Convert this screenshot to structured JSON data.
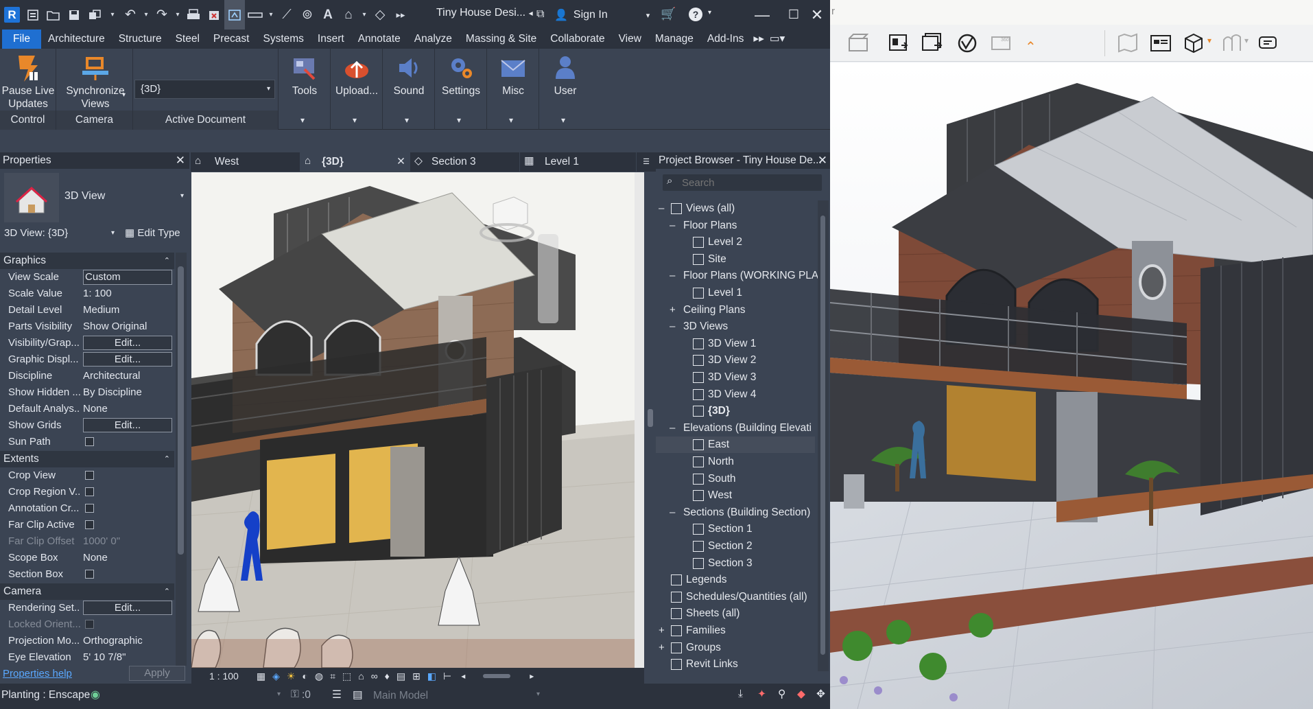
{
  "app": {
    "title": "Tiny House Desi...",
    "sign_in": "Sign In"
  },
  "menu": [
    "File",
    "Architecture",
    "Structure",
    "Steel",
    "Precast",
    "Systems",
    "Insert",
    "Annotate",
    "Analyze",
    "Massing & Site",
    "Collaborate",
    "View",
    "Manage",
    "Add-Ins"
  ],
  "ribbon": {
    "pause": "Pause Live Updates",
    "sync": "Synchronize Views",
    "active_doc_value": "{3D}",
    "tools": "Tools",
    "upload": "Upload...",
    "sound": "Sound",
    "settings": "Settings",
    "misc": "Misc",
    "user": "User",
    "groups": {
      "control": "Control",
      "camera": "Camera",
      "active_document": "Active Document"
    }
  },
  "properties": {
    "title": "Properties",
    "type_name": "3D View",
    "selector": "3D View: {3D}",
    "edit_type": "Edit Type",
    "sections": {
      "graphics": "Graphics",
      "extents": "Extents",
      "camera": "Camera"
    },
    "rows": [
      {
        "k": "View Scale",
        "v": "Custom"
      },
      {
        "k": "Scale Value",
        "pre": "1:",
        "v": "100"
      },
      {
        "k": "Detail Level",
        "v": "Medium"
      },
      {
        "k": "Parts Visibility",
        "v": "Show Original"
      },
      {
        "k": "Visibility/Grap...",
        "v": "Edit..."
      },
      {
        "k": "Graphic Displ...",
        "v": "Edit..."
      },
      {
        "k": "Discipline",
        "v": "Architectural"
      },
      {
        "k": "Show Hidden ...",
        "v": "By Discipline"
      },
      {
        "k": "Default Analys...",
        "v": "None"
      },
      {
        "k": "Show Grids",
        "v": "Edit..."
      },
      {
        "k": "Sun Path",
        "v": ""
      },
      {
        "k": "Crop View",
        "v": ""
      },
      {
        "k": "Crop Region V...",
        "v": ""
      },
      {
        "k": "Annotation Cr...",
        "v": ""
      },
      {
        "k": "Far Clip Active",
        "v": ""
      },
      {
        "k": "Far Clip Offset",
        "v": "1000'  0\""
      },
      {
        "k": "Scope Box",
        "v": "None"
      },
      {
        "k": "Section Box",
        "v": ""
      },
      {
        "k": "Rendering Set...",
        "v": "Edit..."
      },
      {
        "k": "Locked Orient...",
        "v": ""
      },
      {
        "k": "Projection Mo...",
        "v": "Orthographic"
      },
      {
        "k": "Eye Elevation",
        "v": "5'  10 7/8\""
      }
    ],
    "help": "Properties help",
    "apply": "Apply"
  },
  "tabs": [
    "West",
    "{3D}",
    "Section 3",
    "Level 1"
  ],
  "view_bar": {
    "scale": "1 : 100"
  },
  "browser": {
    "title": "Project Browser - Tiny House De...",
    "search_placeholder": "Search",
    "nodes": [
      "Views (all)",
      "Floor Plans",
      "Level 2",
      "Site",
      "Floor Plans (WORKING PLA",
      "Level 1",
      "Ceiling Plans",
      "3D Views",
      "3D View 1",
      "3D View 2",
      "3D View 3",
      "3D View 4",
      "{3D}",
      "Elevations (Building Elevati",
      "East",
      "North",
      "South",
      "West",
      "Sections (Building Section)",
      "Section 1",
      "Section 2",
      "Section 3",
      "Legends",
      "Schedules/Quantities (all)",
      "Sheets (all)",
      "Families",
      "Groups",
      "Revit Links"
    ]
  },
  "status": {
    "text": "Planting : Enscape",
    "count": ":0",
    "model": "Main Model"
  },
  "enscape": {
    "edge_char": "r"
  }
}
